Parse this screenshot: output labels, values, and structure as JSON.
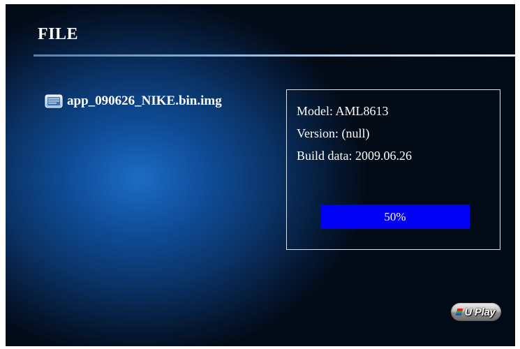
{
  "header": {
    "title": "FILE"
  },
  "file_list": {
    "items": [
      {
        "name": "app_090626_NIKE.bin.img",
        "icon": "file-image-icon"
      }
    ]
  },
  "info_panel": {
    "model": "Model: AML8613",
    "version": "Version: (null)",
    "build_date": "Build data: 2009.06.26"
  },
  "progress": {
    "label": "50%",
    "value_percent": 50
  },
  "branding": {
    "logo_text": "U Play"
  },
  "colors": {
    "progress_bar": "#0000f2",
    "text": "#ffffff",
    "background_center": "#1c6cc4",
    "background_edge": "#020a16"
  }
}
